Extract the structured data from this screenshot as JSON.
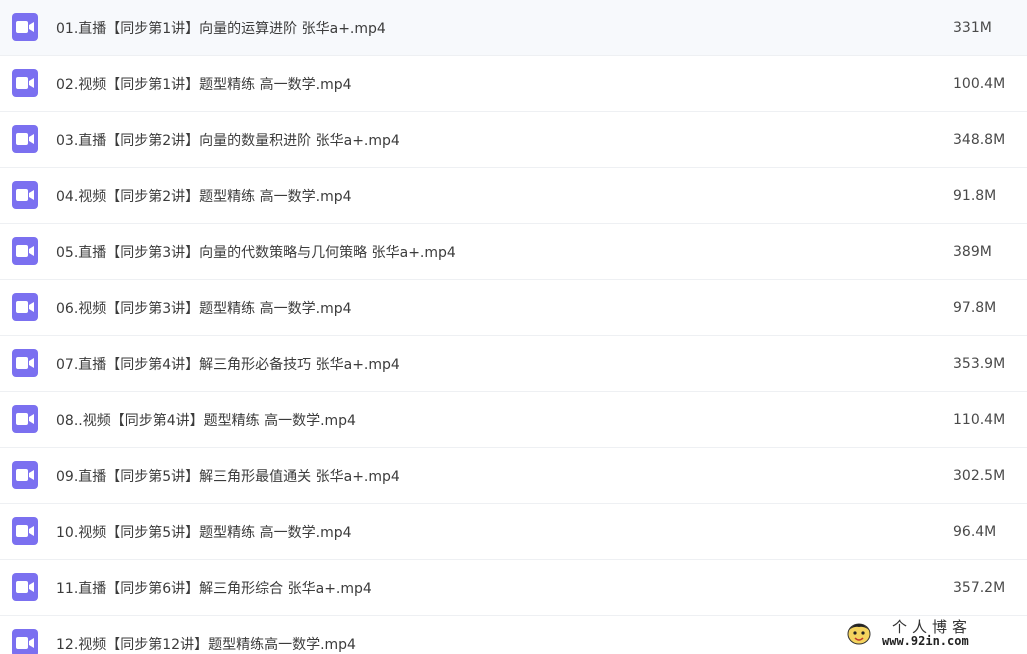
{
  "files": [
    {
      "name": "01.直播【同步第1讲】向量的运算进阶 张华a+.mp4",
      "size": "331M",
      "icon": "video-file-icon"
    },
    {
      "name": "02.视频【同步第1讲】题型精练 高一数学.mp4",
      "size": "100.4M",
      "icon": "video-file-icon"
    },
    {
      "name": "03.直播【同步第2讲】向量的数量积进阶 张华a+.mp4",
      "size": "348.8M",
      "icon": "video-file-icon"
    },
    {
      "name": "04.视频【同步第2讲】题型精练 高一数学.mp4",
      "size": "91.8M",
      "icon": "video-file-icon"
    },
    {
      "name": "05.直播【同步第3讲】向量的代数策略与几何策略 张华a+.mp4",
      "size": "389M",
      "icon": "video-file-icon"
    },
    {
      "name": "06.视频【同步第3讲】题型精练 高一数学.mp4",
      "size": "97.8M",
      "icon": "video-file-icon"
    },
    {
      "name": "07.直播【同步第4讲】解三角形必备技巧 张华a+.mp4",
      "size": "353.9M",
      "icon": "video-file-icon"
    },
    {
      "name": "08..视频【同步第4讲】题型精练 高一数学.mp4",
      "size": "110.4M",
      "icon": "video-file-icon"
    },
    {
      "name": "09.直播【同步第5讲】解三角形最值通关 张华a+.mp4",
      "size": "302.5M",
      "icon": "video-file-icon"
    },
    {
      "name": "10.视频【同步第5讲】题型精练 高一数学.mp4",
      "size": "96.4M",
      "icon": "video-file-icon"
    },
    {
      "name": "11.直播【同步第6讲】解三角形综合 张华a+.mp4",
      "size": "357.2M",
      "icon": "video-file-icon"
    },
    {
      "name": "12.视频【同步第12讲】题型精练高一数学.mp4",
      "size": "",
      "icon": "video-file-icon"
    }
  ],
  "watermark": {
    "title": "个人博客",
    "url": "www.92in.com"
  },
  "colors": {
    "icon_bg": "#7b70f0",
    "divider": "#eef0f3",
    "text": "#3b3b3b"
  }
}
